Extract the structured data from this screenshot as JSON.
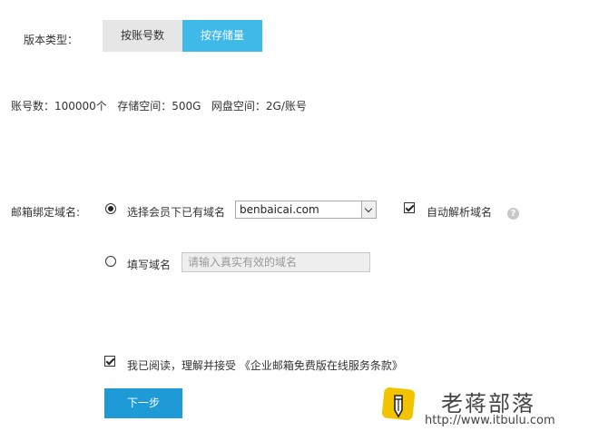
{
  "version_type": {
    "label": "版本类型：",
    "tabs": [
      {
        "label": "按账号数",
        "active": false
      },
      {
        "label": "按存储量",
        "active": true
      }
    ]
  },
  "summary": "账号数：100000个   存储空间：500G   网盘空间：2G/账号",
  "domain_binding": {
    "label": "邮箱绑定域名:",
    "option_existing": {
      "label": "选择会员下已有域名",
      "selected": true
    },
    "domain_select_value": "benbaicai.com",
    "auto_parse": {
      "label": "自动解析域名",
      "checked": true
    },
    "help_icon": "?",
    "option_fill": {
      "label": "填写域名",
      "selected": false
    },
    "fill_placeholder": "请输入真实有效的域名"
  },
  "agreement": {
    "text": "我已阅读，理解并接受 《企业邮箱免费版在线服务条款》",
    "checked": true
  },
  "next_button": "下一步",
  "watermark": {
    "title": "老蒋部落",
    "url": "http://www.itbulu.com"
  },
  "colors": {
    "accent": "#3fb9e8",
    "button": "#1e9ad6",
    "logo": "#f2c400"
  }
}
